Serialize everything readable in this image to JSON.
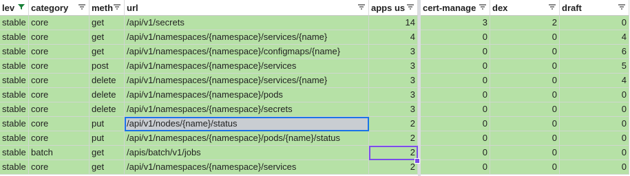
{
  "headers": [
    {
      "label": "lev",
      "filter": "active"
    },
    {
      "label": "category",
      "filter": "lines"
    },
    {
      "label": "meth",
      "filter": "lines"
    },
    {
      "label": "url",
      "filter": "lines"
    },
    {
      "label": "apps us",
      "filter": "lines"
    },
    {
      "label": "cert-manage",
      "filter": "lines"
    },
    {
      "label": "dex",
      "filter": "lines"
    },
    {
      "label": "draft",
      "filter": "lines"
    }
  ],
  "rows": [
    {
      "level": "stable",
      "category": "core",
      "method": "get",
      "url": "/api/v1/secrets",
      "apps": "14",
      "cert": "3",
      "dex": "2",
      "draft": "0"
    },
    {
      "level": "stable",
      "category": "core",
      "method": "get",
      "url": "/api/v1/namespaces/{namespace}/services/{name}",
      "apps": "4",
      "cert": "0",
      "dex": "0",
      "draft": "4"
    },
    {
      "level": "stable",
      "category": "core",
      "method": "get",
      "url": "/api/v1/namespaces/{namespace}/configmaps/{name}",
      "apps": "3",
      "cert": "0",
      "dex": "0",
      "draft": "6"
    },
    {
      "level": "stable",
      "category": "core",
      "method": "post",
      "url": "/api/v1/namespaces/{namespace}/services",
      "apps": "3",
      "cert": "0",
      "dex": "0",
      "draft": "5"
    },
    {
      "level": "stable",
      "category": "core",
      "method": "delete",
      "url": "/api/v1/namespaces/{namespace}/services/{name}",
      "apps": "3",
      "cert": "0",
      "dex": "0",
      "draft": "4"
    },
    {
      "level": "stable",
      "category": "core",
      "method": "delete",
      "url": "/api/v1/namespaces/{namespace}/pods",
      "apps": "3",
      "cert": "0",
      "dex": "0",
      "draft": "0"
    },
    {
      "level": "stable",
      "category": "core",
      "method": "delete",
      "url": "/api/v1/namespaces/{namespace}/secrets",
      "apps": "3",
      "cert": "0",
      "dex": "0",
      "draft": "0"
    },
    {
      "level": "stable",
      "category": "core",
      "method": "put",
      "url": "/api/v1/nodes/{name}/status",
      "apps": "2",
      "cert": "0",
      "dex": "0",
      "draft": "0"
    },
    {
      "level": "stable",
      "category": "core",
      "method": "put",
      "url": "/api/v1/namespaces/{namespace}/pods/{name}/status",
      "apps": "2",
      "cert": "0",
      "dex": "0",
      "draft": "0"
    },
    {
      "level": "stable",
      "category": "batch",
      "method": "get",
      "url": "/apis/batch/v1/jobs",
      "apps": "2",
      "cert": "0",
      "dex": "0",
      "draft": "0"
    },
    {
      "level": "stable",
      "category": "core",
      "method": "get",
      "url": "/api/v1/namespaces/{namespace}/services",
      "apps": "2",
      "cert": "0",
      "dex": "0",
      "draft": "0"
    }
  ],
  "colors": {
    "row_fill": "#b6e1a6",
    "selection": "#1a73e8",
    "secondary_selection": "#7b4ee8",
    "filter_active": "#188038"
  }
}
